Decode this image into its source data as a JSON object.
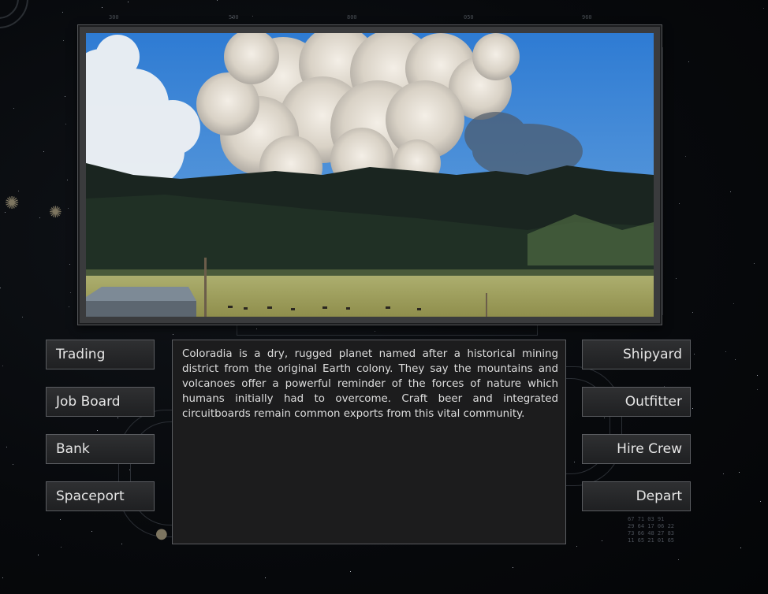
{
  "planet": {
    "description": "Coloradia is a dry, rugged planet named after a historical mining district from the original Earth colony. They say the mountains and volcanoes offer a powerful reminder of the forces of nature which humans initially had to overcome. Craft beer and integrated circuitboards remain common exports from this vital community."
  },
  "left_menu": [
    {
      "label": "Trading"
    },
    {
      "label": "Job Board"
    },
    {
      "label": "Bank"
    },
    {
      "label": "Spaceport"
    }
  ],
  "right_menu": [
    {
      "label": "Shipyard"
    },
    {
      "label": "Outfitter"
    },
    {
      "label": "Hire Crew"
    },
    {
      "label": "Depart"
    }
  ],
  "ruler_ticks": [
    "300",
    "500",
    "800",
    "050",
    "960"
  ],
  "readout": "67 71 03 91\n29 64 17 06 22\n73 66 48 27 83\n11 65 21 01 65",
  "colors": {
    "sky": "#3f86d6",
    "smoke": "#e8e2d8",
    "mountain": "#1c2b24",
    "grass": "#b8b46a",
    "panel": "#1c1c1d",
    "border": "#5a5c60"
  }
}
